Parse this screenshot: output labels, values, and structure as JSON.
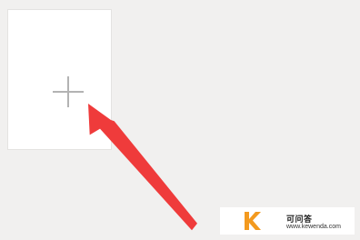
{
  "add_tile": {
    "icon": "plus-icon",
    "colors": {
      "tile_background": "#ffffff",
      "plus": "#b3b3b3"
    }
  },
  "annotation": {
    "type": "arrow",
    "color": "#ef3b3b"
  },
  "watermark": {
    "logo": "K",
    "name": "可问答",
    "url": "www.kewenda.com",
    "colors": {
      "logo": "#f39a1f"
    }
  },
  "page": {
    "background": "#f1f0ef"
  }
}
